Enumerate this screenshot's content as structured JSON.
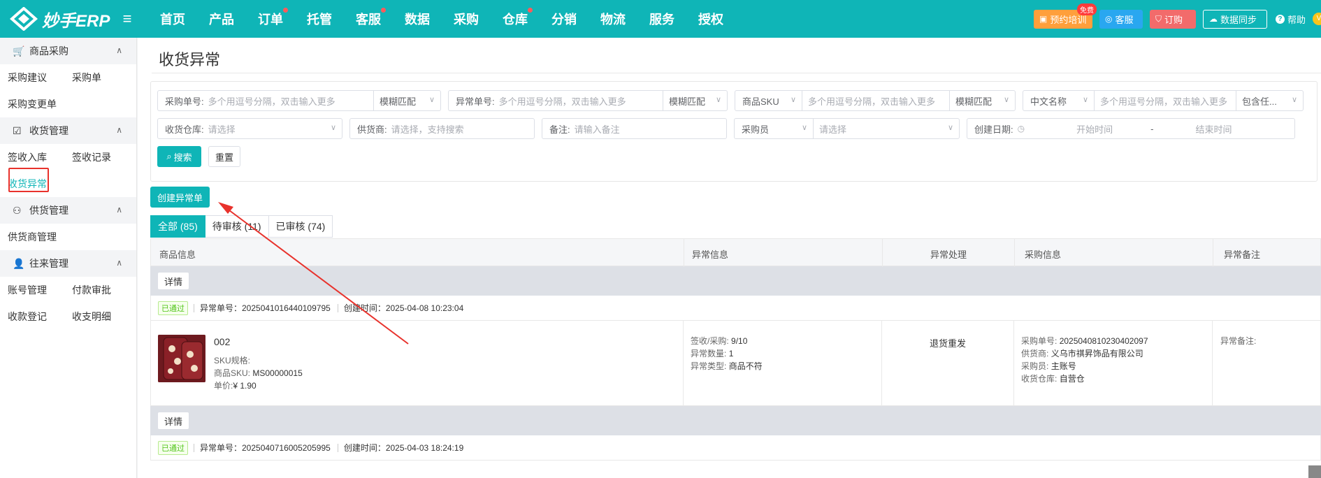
{
  "app": {
    "logo_text": "妙手ERP"
  },
  "nav": {
    "items": [
      {
        "label": "首页",
        "dot": false
      },
      {
        "label": "产品",
        "dot": false
      },
      {
        "label": "订单",
        "dot": true
      },
      {
        "label": "托管",
        "dot": false
      },
      {
        "label": "客服",
        "dot": true
      },
      {
        "label": "数据",
        "dot": false
      },
      {
        "label": "采购",
        "dot": false
      },
      {
        "label": "仓库",
        "dot": true
      },
      {
        "label": "分销",
        "dot": false
      },
      {
        "label": "物流",
        "dot": false
      },
      {
        "label": "服务",
        "dot": false
      },
      {
        "label": "授权",
        "dot": false
      }
    ],
    "training_label": "预约培训",
    "training_badge": "免费",
    "service_label": "客服",
    "order_label": "订购",
    "sync_label": "数据同步",
    "help_label": "帮助",
    "avatar_letter": "V"
  },
  "sidebar": {
    "groups": [
      {
        "title": "商品采购",
        "icon": "cart-icon",
        "links": [
          [
            "采购建议",
            "采购单"
          ],
          [
            "采购变更单"
          ]
        ]
      },
      {
        "title": "收货管理",
        "icon": "checklist-icon",
        "links": [
          [
            "签收入库",
            "签收记录"
          ],
          [
            "收货异常"
          ]
        ]
      },
      {
        "title": "供货管理",
        "icon": "supplier-icon",
        "links": [
          [
            "供货商管理"
          ]
        ]
      },
      {
        "title": "往来管理",
        "icon": "user-icon",
        "links": [
          [
            "账号管理",
            "付款审批"
          ],
          [
            "收款登记",
            "收支明细"
          ]
        ]
      }
    ]
  },
  "page": {
    "title": "收货异常"
  },
  "filters": {
    "purchase_no_label": "采购单号:",
    "purchase_no_placeholder": "多个用逗号分隔，双击输入更多",
    "match1": "模糊匹配",
    "exception_no_label": "异常单号:",
    "exception_no_placeholder": "多个用逗号分隔，双击输入更多",
    "match2": "模糊匹配",
    "sku_select": "商品SKU",
    "sku_placeholder": "多个用逗号分隔，双击输入更多",
    "match3": "模糊匹配",
    "cn_name_select": "中文名称",
    "cn_name_placeholder": "多个用逗号分隔，双击输入更多",
    "match4": "包含任...",
    "warehouse_label": "收货仓库:",
    "warehouse_placeholder": "请选择",
    "supplier_label": "供货商:",
    "supplier_placeholder": "请选择，支持搜索",
    "remark_label": "备注:",
    "remark_placeholder": "请输入备注",
    "buyer_select": "采购员",
    "buyer_placeholder": "请选择",
    "date_label": "创建日期:",
    "date_start": "开始时间",
    "date_sep": "-",
    "date_end": "结束时间",
    "search_label": "搜索",
    "reset_label": "重置"
  },
  "actions": {
    "create_label": "创建异常单"
  },
  "tabs": [
    {
      "label": "全部 (85)",
      "active": true
    },
    {
      "label": "待审核 (11)",
      "active": false
    },
    {
      "label": "已审核 (74)",
      "active": false
    }
  ],
  "table": {
    "headers": [
      "商品信息",
      "异常信息",
      "异常处理",
      "采购信息",
      "异常备注"
    ],
    "detail_label": "详情",
    "rows": [
      {
        "status": "已通过",
        "exception_no": "异常单号：2025041016440109795",
        "created": "创建时间：2025-04-08 10:23:04",
        "product_name": "002",
        "sku_spec_label": "SKU规格:",
        "sku_label": "商品SKU:",
        "sku_value": "MS00000015",
        "price_label": "单价:",
        "price_value": "¥ 1.90",
        "recv_label": "签收/采购:",
        "recv_value": "9/10",
        "qty_label": "异常数量:",
        "qty_value": "1",
        "type_label": "异常类型:",
        "type_value": "商品不符",
        "handling": "退货重发",
        "po_label": "采购单号:",
        "po_value": "2025040810230402097",
        "supplier_label": "供货商:",
        "supplier_value": "义乌市祺昇饰品有限公司",
        "buyer_label": "采购员:",
        "buyer_value": "主账号",
        "wh_label": "收货仓库:",
        "wh_value": "自营仓",
        "remark_label": "异常备注:"
      },
      {
        "status": "已通过",
        "exception_no": "异常单号：2025040716005205995",
        "created": "创建时间：2025-04-03 18:24:19"
      }
    ]
  },
  "colors": {
    "primary": "#0fb5b7",
    "annotation": "#e8322c"
  }
}
